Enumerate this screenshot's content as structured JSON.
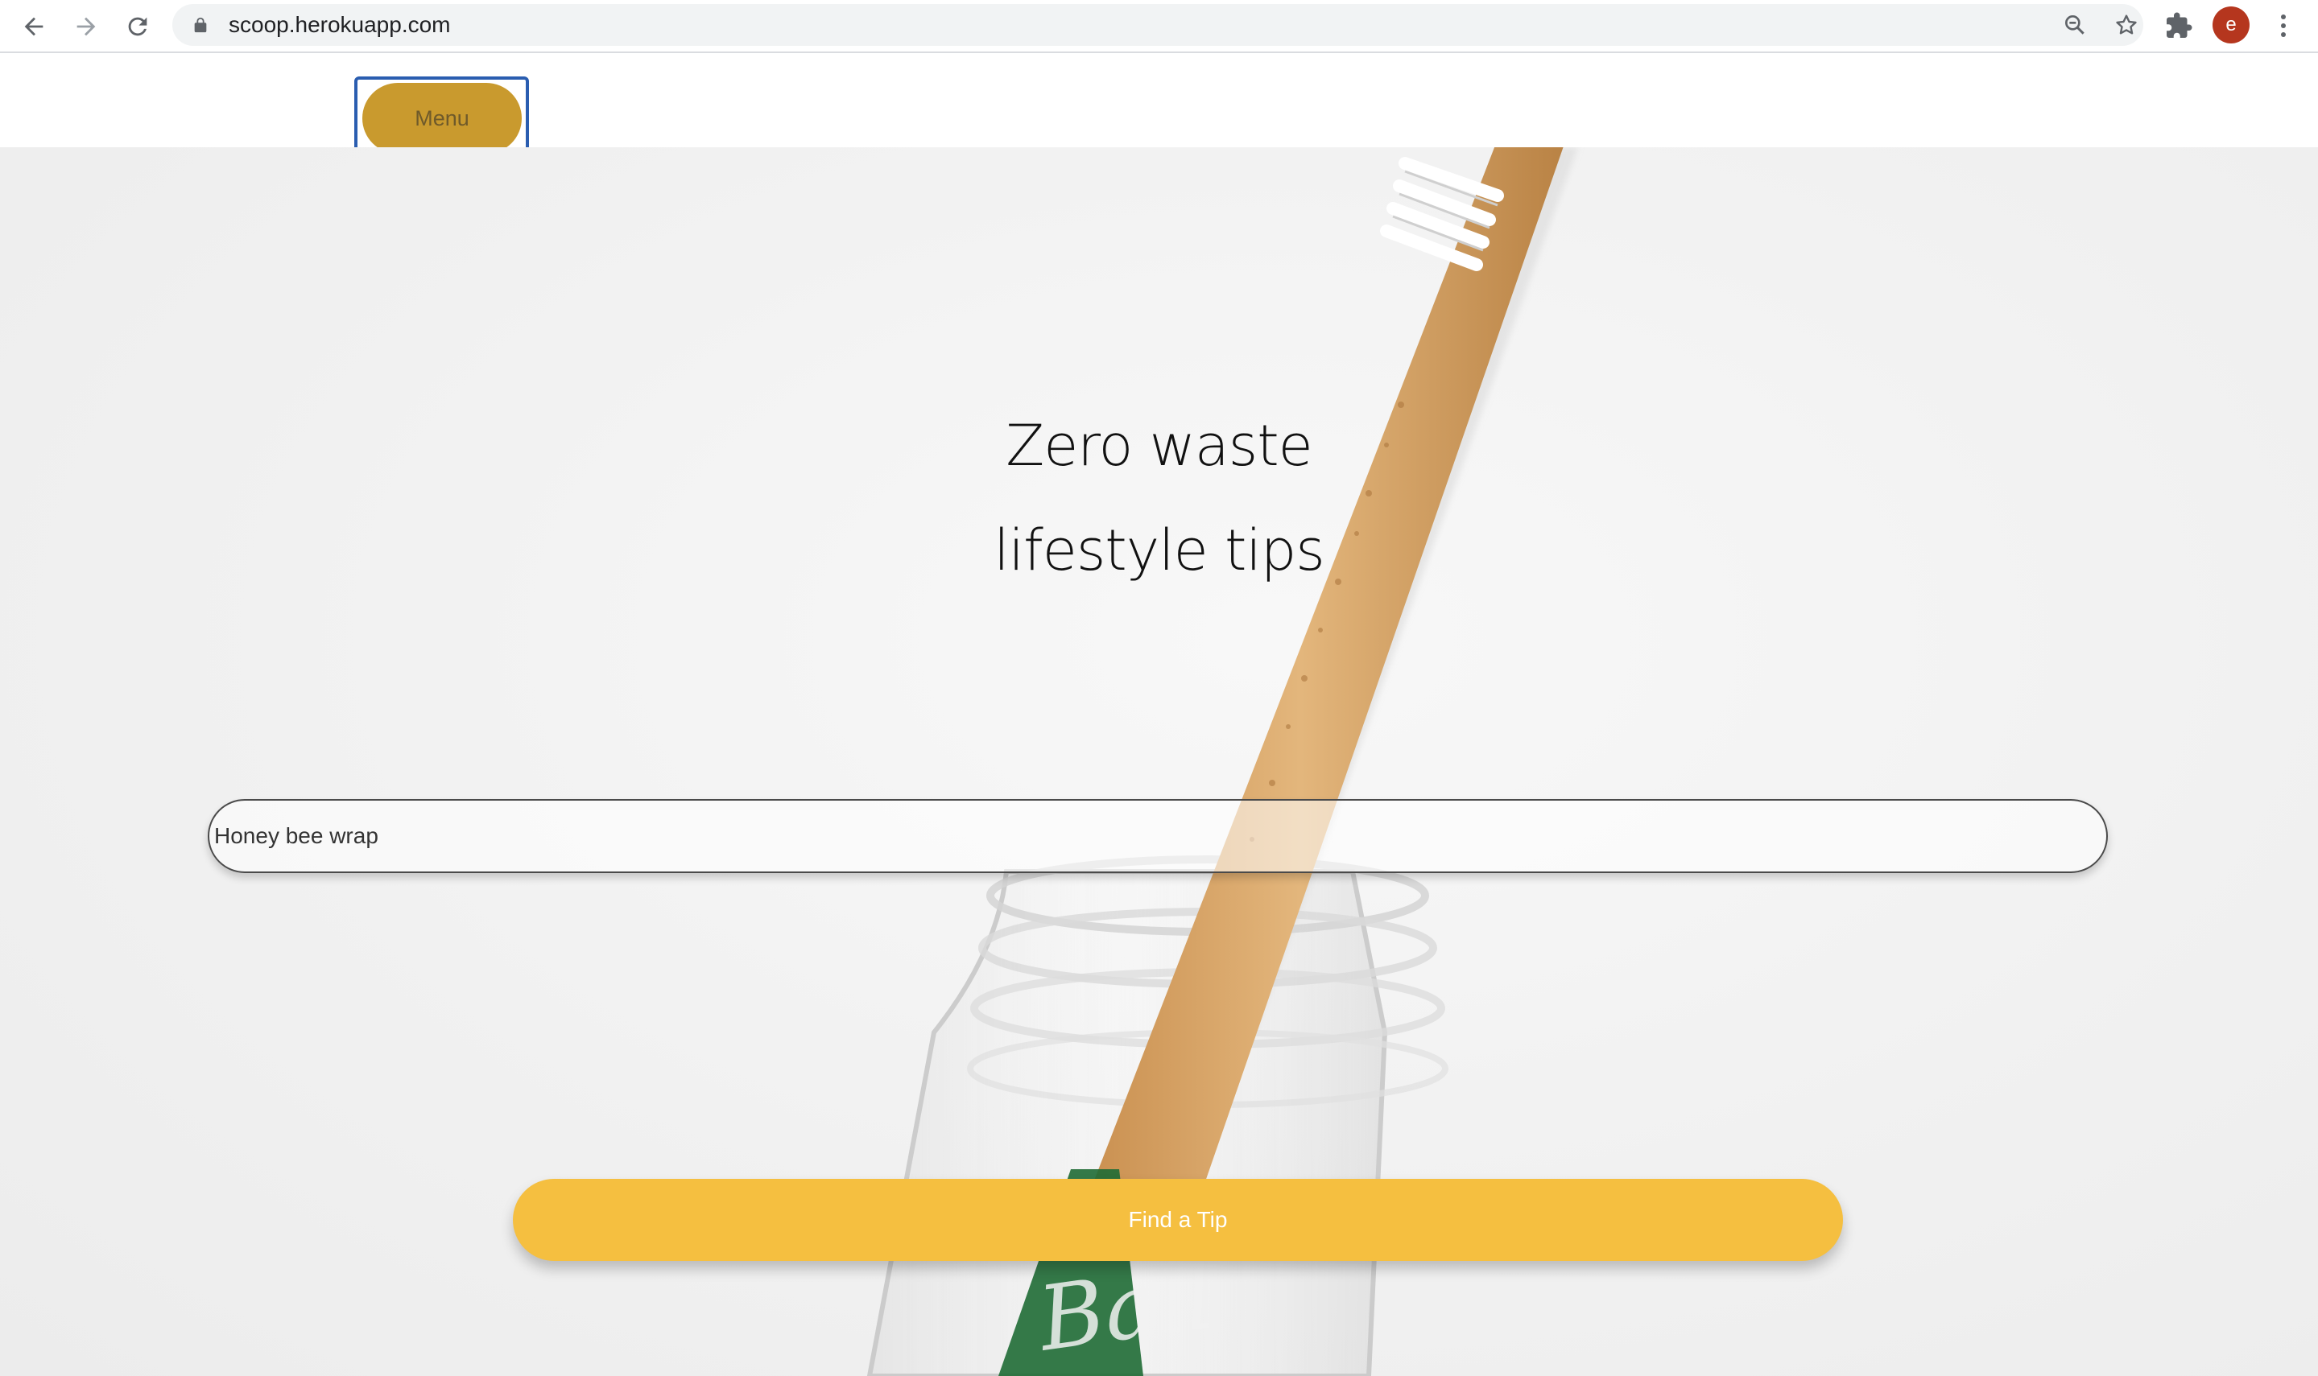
{
  "browser": {
    "url": "scoop.herokuapp.com",
    "profile_initial": "e",
    "icons": {
      "back": "back-arrow-icon",
      "forward": "forward-arrow-icon",
      "reload": "reload-icon",
      "lock": "lock-icon",
      "zoom": "zoom-icon",
      "bookmark": "star-icon",
      "extensions": "puzzle-icon",
      "menu": "kebab-menu-icon"
    },
    "colors": {
      "avatar": "#b5361e",
      "omnibox": "#f1f3f4"
    }
  },
  "header": {
    "menu_label": "Menu"
  },
  "hero": {
    "title_line1": "Zero waste",
    "title_line2": "lifestyle tips"
  },
  "search": {
    "value": "Honey bee wrap"
  },
  "cta": {
    "label": "Find a Tip"
  },
  "colors": {
    "menu_button": "#c99a2e",
    "focus_ring": "#2a5db0",
    "cta_button": "#f5bf40"
  }
}
